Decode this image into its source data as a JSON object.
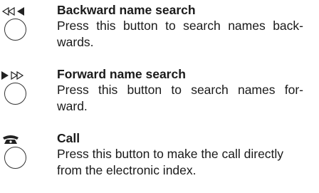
{
  "entries": [
    {
      "icon": "rewind-icon",
      "title": "Backward name search",
      "description_lines": [
        "Press this button to search names back-",
        "wards."
      ]
    },
    {
      "icon": "fast-forward-icon",
      "title": "Forward name search",
      "description_lines": [
        "Press this button to search names for-",
        "ward."
      ]
    },
    {
      "icon": "telephone-handset-icon",
      "title": "Call",
      "description_lines": [
        "Press this button to make the call directly",
        "from the electronic index."
      ]
    }
  ],
  "colors": {
    "text": "#1a1a1a",
    "symbol": "#222222",
    "button_outline": "#333333"
  }
}
